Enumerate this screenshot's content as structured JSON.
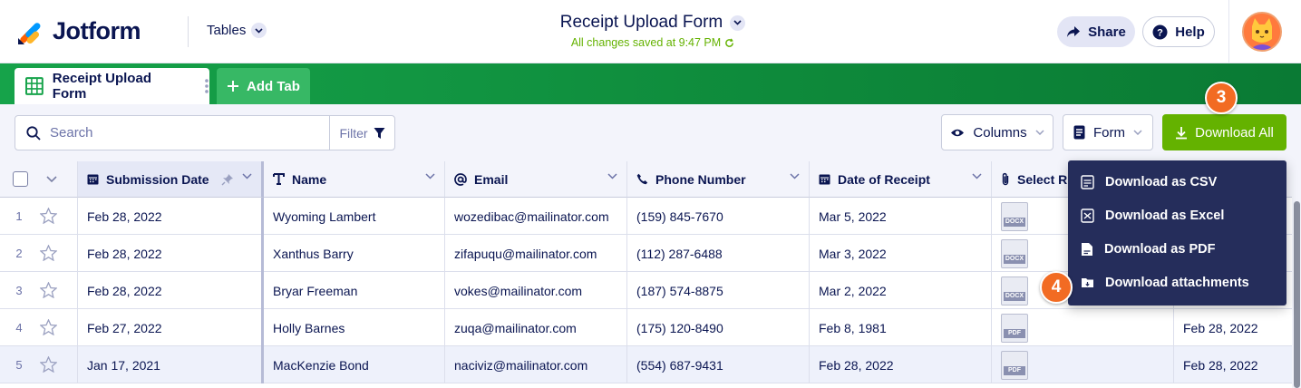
{
  "header": {
    "logo_text": "Jotform",
    "tables_label": "Tables",
    "form_title": "Receipt Upload Form",
    "saved_status": "All changes saved at 9:47 PM",
    "share_label": "Share",
    "help_label": "Help"
  },
  "tabs": {
    "active_label": "Receipt Upload Form",
    "add_label": "Add Tab"
  },
  "toolbar": {
    "search_placeholder": "Search",
    "filter_label": "Filter",
    "columns_label": "Columns",
    "form_label": "Form",
    "download_all_label": "Download All"
  },
  "badges": {
    "step3": "3",
    "step4": "4"
  },
  "columns": [
    {
      "label": "Submission Date",
      "icon": "calendar-icon"
    },
    {
      "label": "Name",
      "icon": "text-icon"
    },
    {
      "label": "Email",
      "icon": "at-icon"
    },
    {
      "label": "Phone Number",
      "icon": "phone-icon"
    },
    {
      "label": "Date of Receipt",
      "icon": "calendar-icon"
    },
    {
      "label": "Select R",
      "icon": "paperclip-icon"
    }
  ],
  "rows": [
    {
      "num": "1",
      "date": "Feb 28, 2022",
      "name": "Wyoming Lambert",
      "email": "wozedibac@mailinator.com",
      "phone": "(159) 845-7670",
      "receipt": "Mar 5, 2022",
      "file": "DOCX",
      "extra": ""
    },
    {
      "num": "2",
      "date": "Feb 28, 2022",
      "name": "Xanthus Barry",
      "email": "zifapuqu@mailinator.com",
      "phone": "(112) 287-6488",
      "receipt": "Mar 3, 2022",
      "file": "DOCX",
      "extra": ""
    },
    {
      "num": "3",
      "date": "Feb 28, 2022",
      "name": "Bryar Freeman",
      "email": "vokes@mailinator.com",
      "phone": "(187) 574-8875",
      "receipt": "Mar 2, 2022",
      "file": "DOCX",
      "extra": ""
    },
    {
      "num": "4",
      "date": "Feb 27, 2022",
      "name": "Holly Barnes",
      "email": "zuqa@mailinator.com",
      "phone": "(175) 120-8490",
      "receipt": "Feb 8, 1981",
      "file": "PDF",
      "extra": "Feb 28, 2022"
    },
    {
      "num": "5",
      "date": "Jan 17, 2021",
      "name": "MacKenzie Bond",
      "email": "naciviz@mailinator.com",
      "phone": "(554) 687-9431",
      "receipt": "Feb 28, 2022",
      "file": "PDF",
      "extra": "Feb 28, 2022"
    }
  ],
  "download_menu": [
    {
      "label": "Download as CSV",
      "icon": "csv-icon"
    },
    {
      "label": "Download as Excel",
      "icon": "excel-icon"
    },
    {
      "label": "Download as PDF",
      "icon": "pdf-icon"
    },
    {
      "label": "Download attachments",
      "icon": "folder-icon"
    }
  ],
  "colors": {
    "brand_navy": "#0a1551",
    "green_bar": "#0e8a3b",
    "download_green": "#64b200",
    "badge_orange": "#f26b23",
    "menu_bg": "#252d5b"
  }
}
